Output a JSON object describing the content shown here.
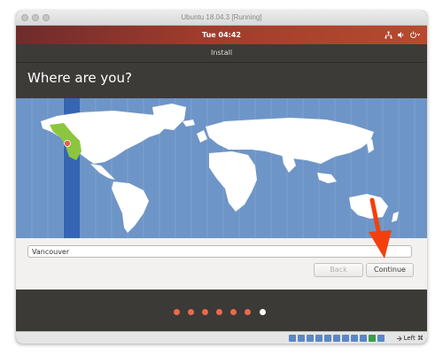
{
  "vm_window": {
    "title": "Ubuntu 18.04.3 [Running]"
  },
  "topbar": {
    "clock": "Tue 04:42",
    "tray_icons": [
      "network-icon",
      "volume-icon",
      "power-icon"
    ]
  },
  "installer": {
    "header_title": "Install",
    "page_title": "Where are you?",
    "location_value": "Vancouver",
    "location_placeholder": "",
    "back_label": "Back",
    "continue_label": "Continue",
    "progress": {
      "steps_total": 7,
      "current_step": 7
    }
  },
  "statusbar": {
    "host_key_label": "Left ⌘"
  },
  "colors": {
    "ubuntu_orange": "#e95420",
    "map_sea": "#6e95c7",
    "map_land": "#ffffff",
    "timezone_highlight": "#3565b3",
    "selected_region": "#8cc63f",
    "pin": "#e0604d",
    "arrow": "#f33f0e"
  }
}
